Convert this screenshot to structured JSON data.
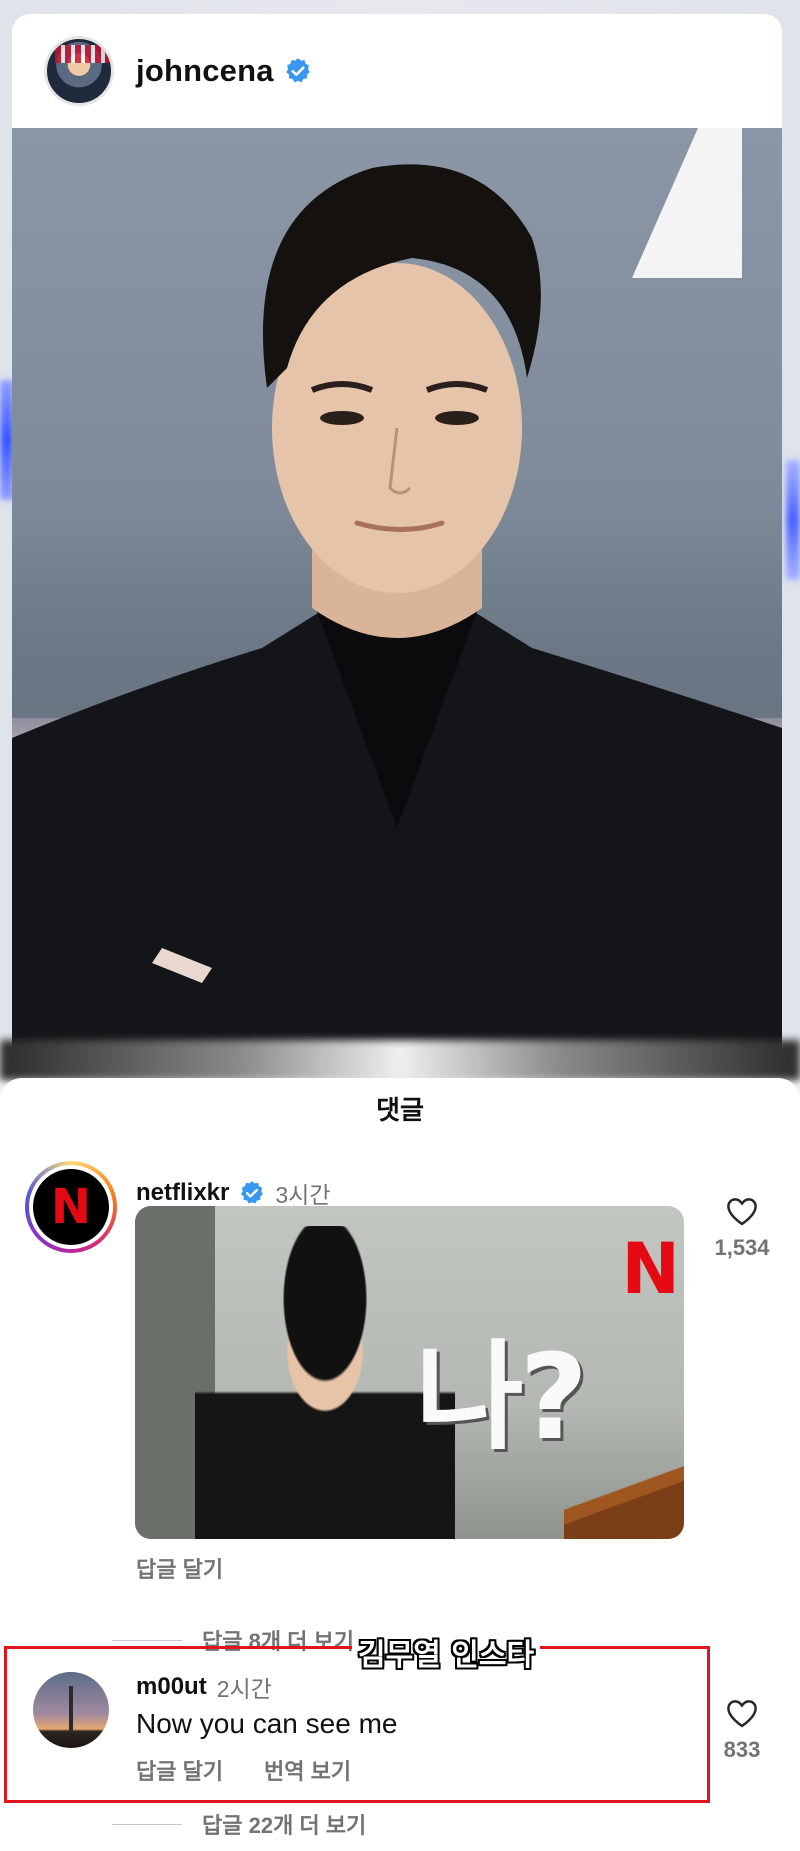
{
  "post": {
    "username": "johncena",
    "photo_alt": "photo"
  },
  "sheet": {
    "title": "댓글"
  },
  "comments": [
    {
      "username": "netflixkr",
      "verified": true,
      "time": "3시간",
      "avatar_letter": "N",
      "image_caption": "나?",
      "image_logo": "N",
      "reply_label": "답글 달기",
      "more_replies": "답글 8개 더 보기",
      "likes": "1,534"
    },
    {
      "username": "m00ut",
      "time": "2시간",
      "text": "Now you can see me",
      "reply_label": "답글 달기",
      "translate_label": "번역 보기",
      "more_replies": "답글 22개 더 보기",
      "likes": "833",
      "highlight_tag": "김무열 인스타"
    }
  ],
  "colors": {
    "verified": "#3897f0",
    "highlight": "#e0161f",
    "netflix_red": "#e50914",
    "secondary_text": "#737373"
  }
}
